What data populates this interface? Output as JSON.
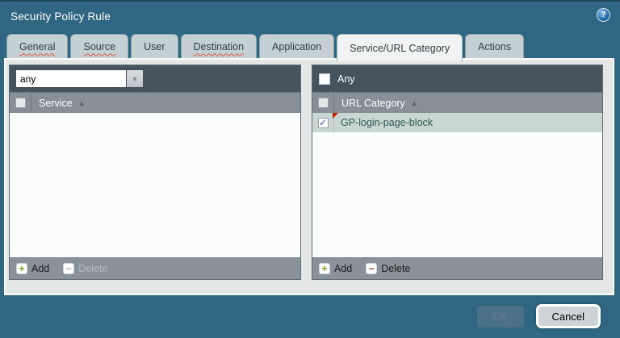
{
  "window": {
    "title": "Security Policy Rule"
  },
  "tabs": [
    {
      "label": "General"
    },
    {
      "label": "Source"
    },
    {
      "label": "User"
    },
    {
      "label": "Destination"
    },
    {
      "label": "Application"
    },
    {
      "label": "Service/URL Category"
    },
    {
      "label": "Actions"
    }
  ],
  "service_panel": {
    "dropdown_value": "any",
    "column_header": "Service",
    "add_label": "Add",
    "delete_label": "Delete",
    "delete_enabled": false,
    "rows": []
  },
  "url_panel": {
    "any_label": "Any",
    "any_checked": false,
    "column_header": "URL Category",
    "add_label": "Add",
    "delete_label": "Delete",
    "delete_enabled": true,
    "rows": [
      {
        "label": "GP-login-page-block",
        "checked": true,
        "modified": true,
        "selected": true
      }
    ]
  },
  "footer": {
    "ok_label": "OK",
    "ok_enabled": false,
    "cancel_label": "Cancel"
  },
  "icons": {
    "help": "?",
    "dropdown_arrow": "▼",
    "sort_asc": "▲",
    "add": "+",
    "remove": "−",
    "check": "✓"
  },
  "colors": {
    "titlebar": "#2f6681",
    "panel-header": "#47535d",
    "column-header": "#879096",
    "panel-footer": "#8a9299",
    "selected-row": "#c9d6d2",
    "row-text": "#2a5c52",
    "add-green": "#76a317",
    "delete-red": "#9c392b",
    "check-blue": "#3657a9",
    "modified-marker": "#c81e00"
  }
}
